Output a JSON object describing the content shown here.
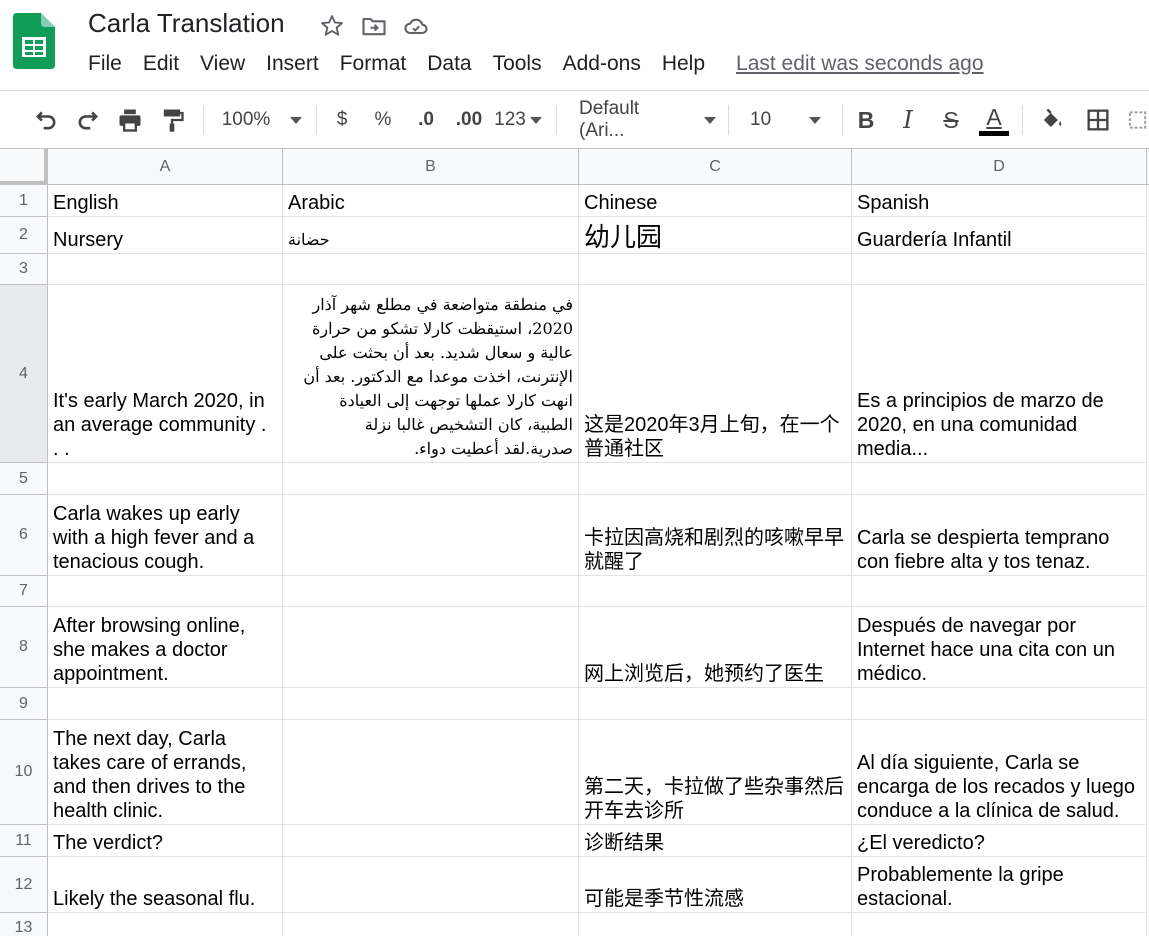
{
  "doc": {
    "title": "Carla Translation",
    "last_edit": "Last edit was seconds ago"
  },
  "icons": {
    "star": "star-icon",
    "move": "move-to-folder-icon",
    "cloud": "cloud-status-icon"
  },
  "menu": [
    "File",
    "Edit",
    "View",
    "Insert",
    "Format",
    "Data",
    "Tools",
    "Add-ons",
    "Help"
  ],
  "toolbar": {
    "zoom": "100%",
    "currency": "$",
    "percent": "%",
    "dec_decrease": ".0",
    "dec_increase": ".00",
    "more_formats": "123",
    "font": "Default (Ari...",
    "font_size": "10",
    "bold": "B",
    "italic": "I",
    "strike": "S",
    "text_color": "A",
    "text_color_value": "#000000"
  },
  "columns": [
    "A",
    "B",
    "C",
    "D"
  ],
  "rows": [
    "1",
    "2",
    "3",
    "4",
    "5",
    "6",
    "7",
    "8",
    "9",
    "10",
    "11",
    "12",
    "13"
  ],
  "cells": {
    "r1": {
      "a": "English",
      "b": "Arabic",
      "c": "Chinese",
      "d": "Spanish"
    },
    "r2": {
      "a": "Nursery",
      "b": "حضانة",
      "c": "幼儿园",
      "d": "Guardería Infantil"
    },
    "r4": {
      "a": "It's early March 2020, in an average community . . .",
      "b": "في منطقة متواضعة في مطلع شهر آذار 2020، استيقظت كارلا تشكو من حرارة عالية و سعال شديد. بعد أن بحثت على الإنترنت، اخذت موعدا مع الدكتور. بعد أن انهت كارلا عملها توجهت إلى العيادة الطبية، كان التشخيص غالبا نزلة صدرية.لقد أعطيت دواء.",
      "c": "这是2020年3月上旬，在一个普通社区",
      "d": "Es a principios de marzo de 2020, en una comunidad media..."
    },
    "r6": {
      "a": "Carla wakes up early with a high fever and a tenacious cough.",
      "c": "卡拉因高烧和剧烈的咳嗽早早就醒了",
      "d": "Carla se despierta temprano con fiebre alta y tos tenaz."
    },
    "r8": {
      "a": "After browsing online, she makes a doctor appointment.",
      "c": "网上浏览后，她预约了医生",
      "d": "Después de navegar por Internet hace una cita con un médico."
    },
    "r10": {
      "a": "The next day, Carla takes care of errands, and then drives to the health clinic.",
      "c": "第二天，卡拉做了些杂事然后开车去诊所",
      "d": "Al día siguiente, Carla se encarga de los recados y luego conduce a la clínica de salud."
    },
    "r11": {
      "a": "The verdict?",
      "c": "诊断结果",
      "d": "¿El veredicto?"
    },
    "r12": {
      "a": "Likely the seasonal flu.",
      "c": "可能是季节性流感",
      "d": "Probablemente la gripe estacional."
    }
  },
  "colors": {
    "sheets_green": "#0f9d58",
    "header_bg": "#f8f9fa",
    "grid_line": "#e2e3e3"
  }
}
